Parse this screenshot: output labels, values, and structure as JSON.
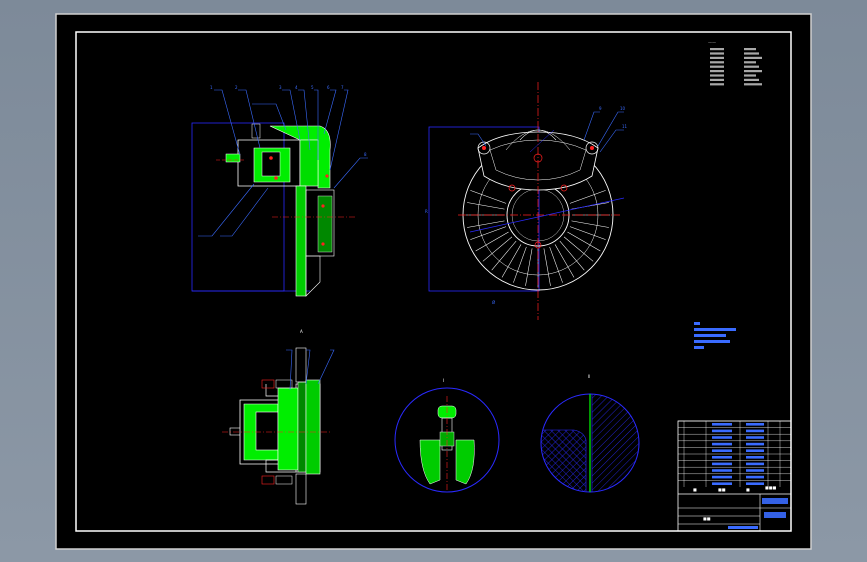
{
  "colors": {
    "background": "#7d8a99",
    "sheet": "#000000",
    "frame": "#ffffff",
    "part_outline": "#1a1aff",
    "section_fill": "#00ff00",
    "hatch": "#00dd00",
    "center_line": "#ff2020",
    "leader": "#3a6bff",
    "dimension": "#2f55ff"
  },
  "icons": {
    "side_view": "caliper-side-section",
    "front_view": "brake-disc-front",
    "section_view": "caliper-cross-section",
    "detail_1": "bleed-screw-detail",
    "detail_2": "disc-edge-detail"
  },
  "view_labels": {
    "section": "A-A",
    "detail_1": "I",
    "detail_2": "II"
  },
  "title_block": {
    "title": "",
    "drawing_name": ""
  }
}
